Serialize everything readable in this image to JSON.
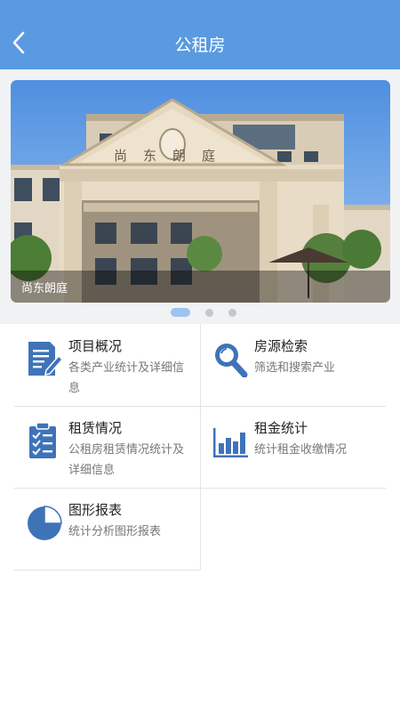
{
  "header": {
    "title": "公租房"
  },
  "banner": {
    "caption": "尚东朗庭",
    "sign_text": "尚东朗庭",
    "active_index": 0,
    "slide_count": 3
  },
  "menu": [
    {
      "title": "项目概况",
      "desc": "各类产业统计及详细信息",
      "icon": "document-edit-icon"
    },
    {
      "title": "房源检索",
      "desc": "筛选和搜索产业",
      "icon": "search-icon"
    },
    {
      "title": "租赁情况",
      "desc": "公租房租赁情况统计及详细信息",
      "icon": "checklist-icon"
    },
    {
      "title": "租金统计",
      "desc": "统计租金收缴情况",
      "icon": "bar-chart-icon"
    },
    {
      "title": "图形报表",
      "desc": "统计分析图形报表",
      "icon": "pie-chart-icon"
    }
  ],
  "colors": {
    "header": "#5a9ae0",
    "icon": "#3f73b8",
    "background": "#f1f2f4"
  }
}
